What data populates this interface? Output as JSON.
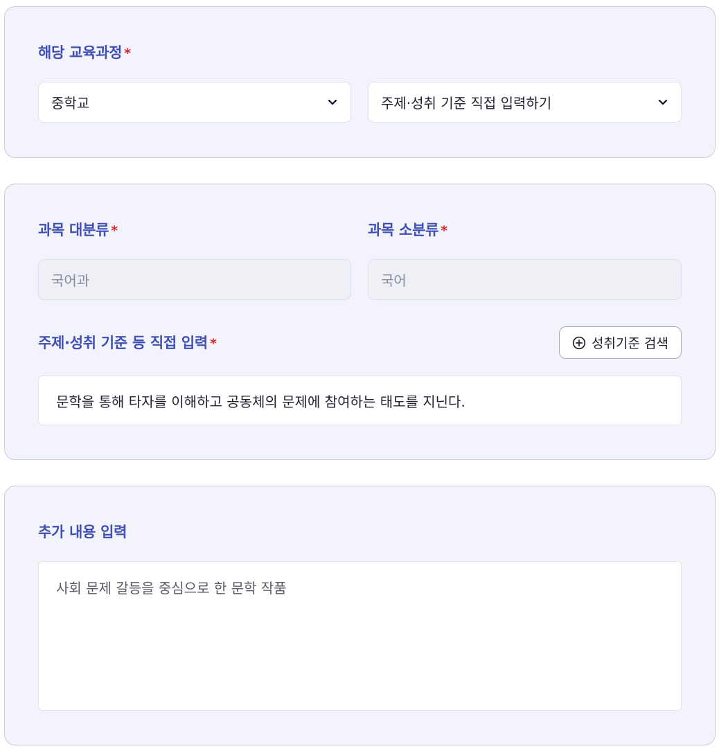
{
  "curriculum": {
    "label": "해당 교육과정",
    "required": "*",
    "school_level": "중학교",
    "input_mode": "주제·성취 기준 직접 입력하기"
  },
  "subject": {
    "major_label": "과목 대분류",
    "minor_label": "과목 소분류",
    "required": "*",
    "major_value": "국어과",
    "minor_value": "국어"
  },
  "standard": {
    "label": "주제·성취 기준 등 직접 입력",
    "required": "*",
    "search_button": "성취기준 검색",
    "value": "문학을 통해 타자를 이해하고 공동체의 문제에 참여하는 태도를 지닌다."
  },
  "extra": {
    "label": "추가 내용 입력",
    "value": "사회 문제 갈등을 중심으로 한 문학 작품"
  },
  "icons": {
    "dropdown": "chevron-down-icon",
    "search_button": "plus-circle-icon"
  },
  "colors": {
    "label": "#3f4fb5",
    "required": "#e0262f",
    "card_bg": "#f3f4fb"
  }
}
